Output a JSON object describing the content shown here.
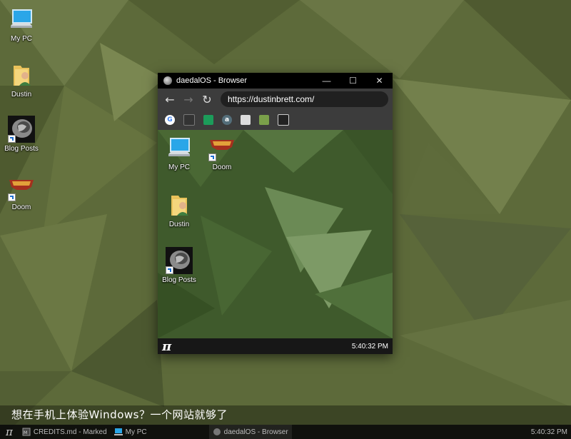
{
  "desktop": {
    "icons": [
      {
        "label": "My PC"
      },
      {
        "label": "Dustin"
      },
      {
        "label": "Blog Posts"
      },
      {
        "label": "Doom"
      }
    ]
  },
  "window": {
    "title": "daedalOS - Browser",
    "controls": {
      "minimize": "—",
      "maximize": "☐",
      "close": "✕"
    },
    "toolbar": {
      "back": "←",
      "forward": "→",
      "reload": "↻"
    },
    "url": "https://dustinbrett.com/",
    "bookmarks": [
      "google-icon",
      "bookmark-2-icon",
      "bookmark-3-icon",
      "bookmark-4-icon",
      "bookmark-5-icon",
      "bookmark-6-icon",
      "bookmark-7-icon"
    ],
    "inner_desktop": {
      "icons": [
        {
          "label": "My PC"
        },
        {
          "label": "Doom"
        },
        {
          "label": "Dustin"
        },
        {
          "label": "Blog Posts"
        }
      ],
      "start_glyph": "π",
      "clock": "5:40:32 PM"
    }
  },
  "subtitle": "想在手机上体验Windows？一个网站就够了",
  "taskbar": {
    "start_glyph": "π",
    "items": [
      {
        "label": "CREDITS.md - Marked"
      },
      {
        "label": "My PC"
      },
      {
        "label": "daedalOS - Browser"
      }
    ],
    "clock": "5:40:32 PM"
  },
  "colors": {
    "accent": "#5d6a3a",
    "inner_bg": "#3f5a2c"
  }
}
